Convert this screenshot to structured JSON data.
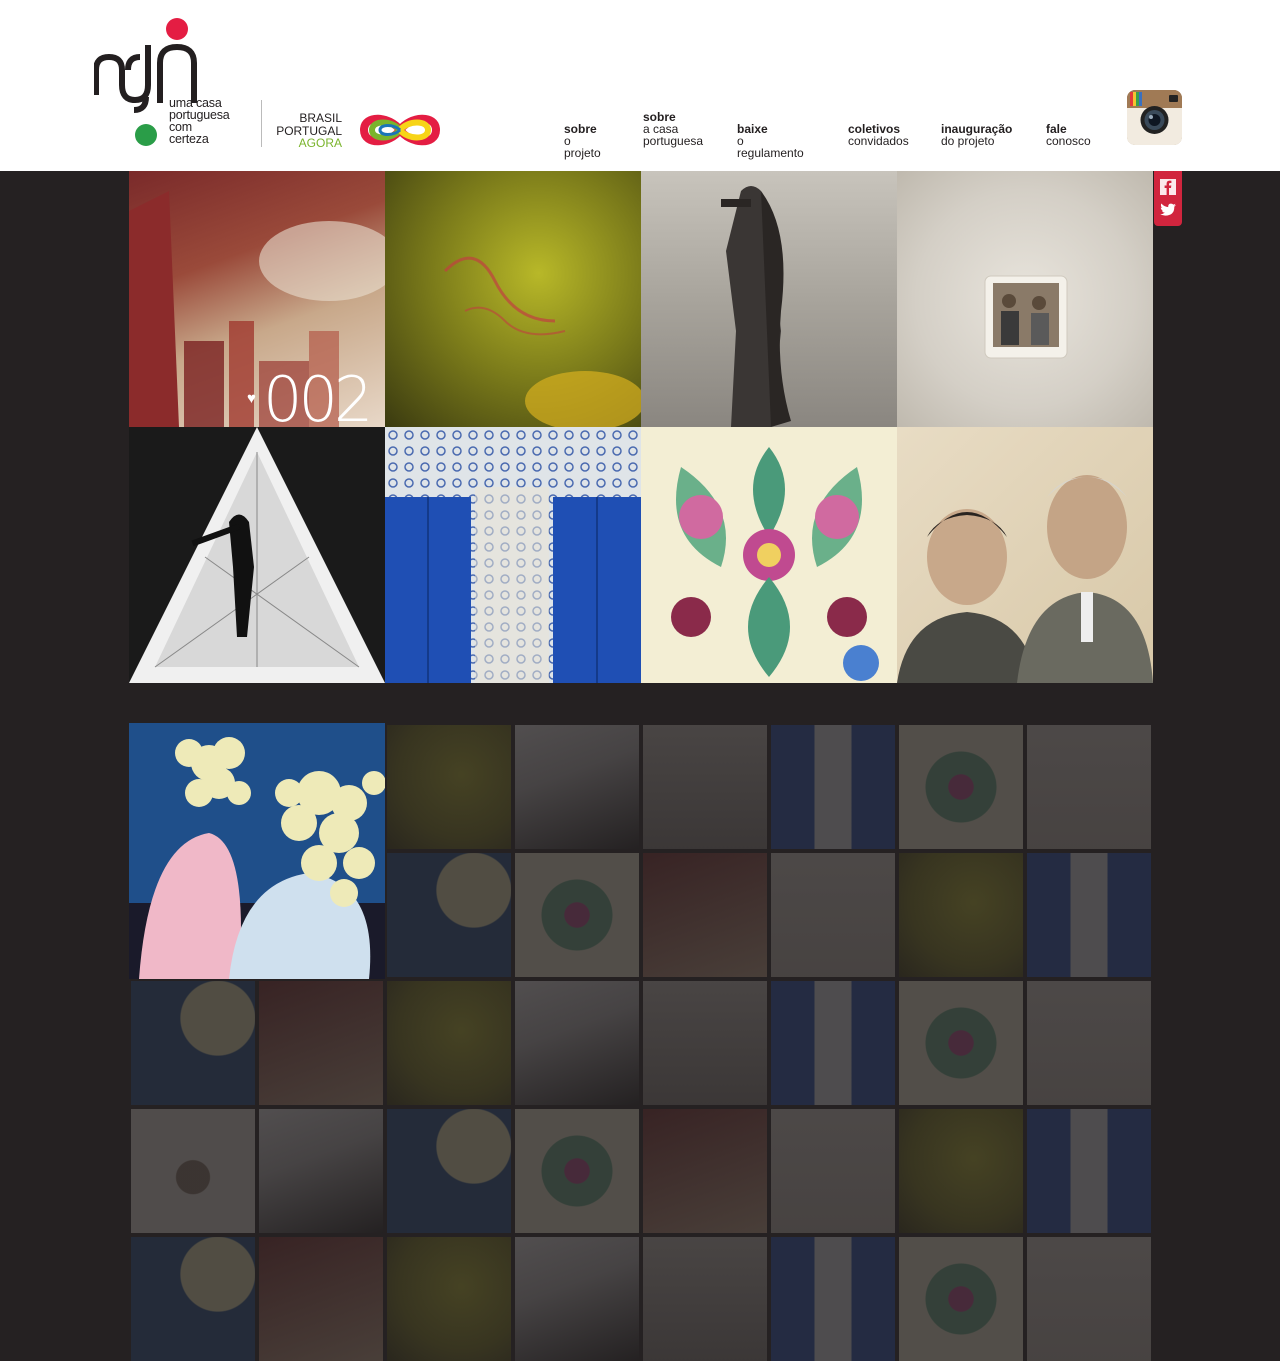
{
  "logo": {
    "line1": "uma casa",
    "line2": "portuguesa",
    "line3": "com",
    "line4": "certeza",
    "partner": [
      "BRASIL",
      "PORTUGAL",
      "AGORA"
    ]
  },
  "nav": [
    {
      "bold": "sobre",
      "rest": [
        "o projeto"
      ]
    },
    {
      "bold": "sobre",
      "rest": [
        "a casa",
        "portuguesa"
      ]
    },
    {
      "bold": "baixe",
      "rest": [
        "o regulamento"
      ]
    },
    {
      "bold": "coletivos",
      "rest": [
        "convidados"
      ]
    },
    {
      "bold": "inauguração",
      "rest": [
        "do projeto"
      ]
    },
    {
      "bold": "fale",
      "rest": [
        "conosco"
      ]
    }
  ],
  "social": {
    "instagram": "instagram-icon",
    "facebook": "facebook-icon",
    "twitter": "twitter-icon"
  },
  "feature": {
    "counter": "002"
  },
  "colors": {
    "accent": "#d1253e",
    "green": "#2a9d48",
    "background": "#252122"
  }
}
